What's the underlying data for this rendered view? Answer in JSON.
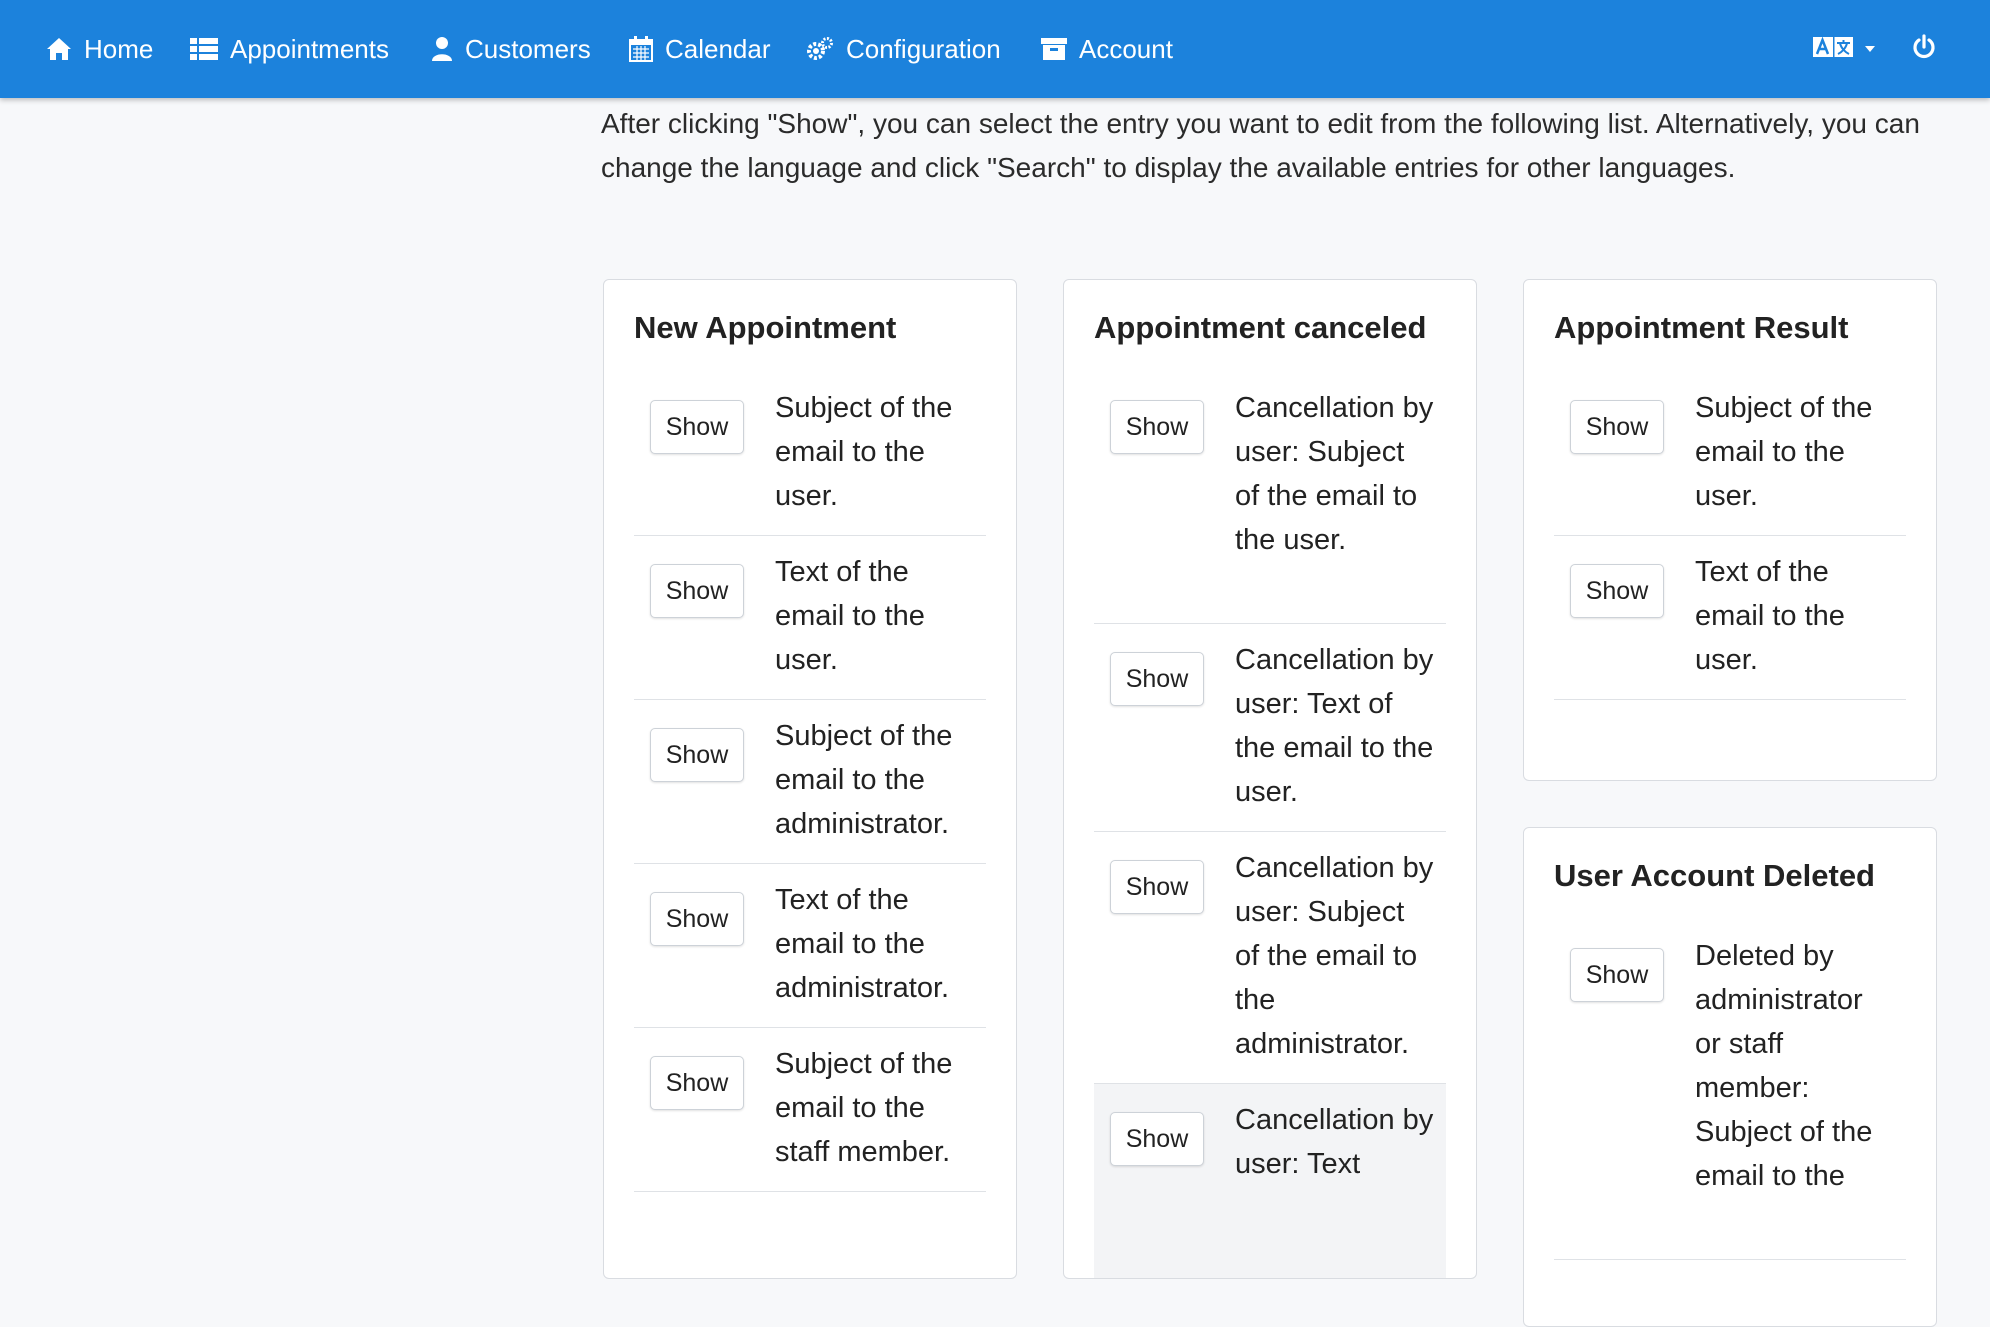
{
  "nav": {
    "items": [
      {
        "label": "Home",
        "icon": "home-icon"
      },
      {
        "label": "Appointments",
        "icon": "list-icon"
      },
      {
        "label": "Customers",
        "icon": "user-icon"
      },
      {
        "label": "Calendar",
        "icon": "calendar-icon"
      },
      {
        "label": "Configuration",
        "icon": "gears-icon"
      },
      {
        "label": "Account",
        "icon": "archive-icon"
      }
    ],
    "language_icon": "language-icon",
    "power_icon": "power-icon"
  },
  "intro_text": "After clicking \"Show\", you can select the entry you want to edit from the following list. Alternatively, you can change the language and click \"Search\" to display the available entries for other languages.",
  "colors": {
    "navbar": "#1c82dc",
    "background": "#f7f8fa"
  },
  "cards": {
    "new_appointment": {
      "title": "New Appointment",
      "rows": [
        {
          "button": "Show",
          "text": "Subject of the email to the user."
        },
        {
          "button": "Show",
          "text": "Text of the email to the user."
        },
        {
          "button": "Show",
          "text": "Subject of the email to the administrator."
        },
        {
          "button": "Show",
          "text": "Text of the email to the administrator."
        },
        {
          "button": "Show",
          "text": "Subject of the email to the staff member."
        }
      ]
    },
    "appointment_canceled": {
      "title": "Appointment canceled",
      "rows": [
        {
          "button": "Show",
          "text": "Cancellation by user: Subject of the email to the user."
        },
        {
          "button": "Show",
          "text": "Cancellation by user: Text of the email to the user."
        },
        {
          "button": "Show",
          "text": "Cancellation by user: Subject of the email to the administrator."
        },
        {
          "button": "Show",
          "text": "Cancellation by user: Text"
        }
      ]
    },
    "appointment_result": {
      "title": "Appointment Result",
      "rows": [
        {
          "button": "Show",
          "text": "Subject of the email to the user."
        },
        {
          "button": "Show",
          "text": "Text of the email to the user."
        }
      ]
    },
    "user_account_deleted": {
      "title": "User Account Deleted",
      "rows": [
        {
          "button": "Show",
          "text": "Deleted by administrator or staff member: Subject of the email to the"
        }
      ]
    }
  }
}
